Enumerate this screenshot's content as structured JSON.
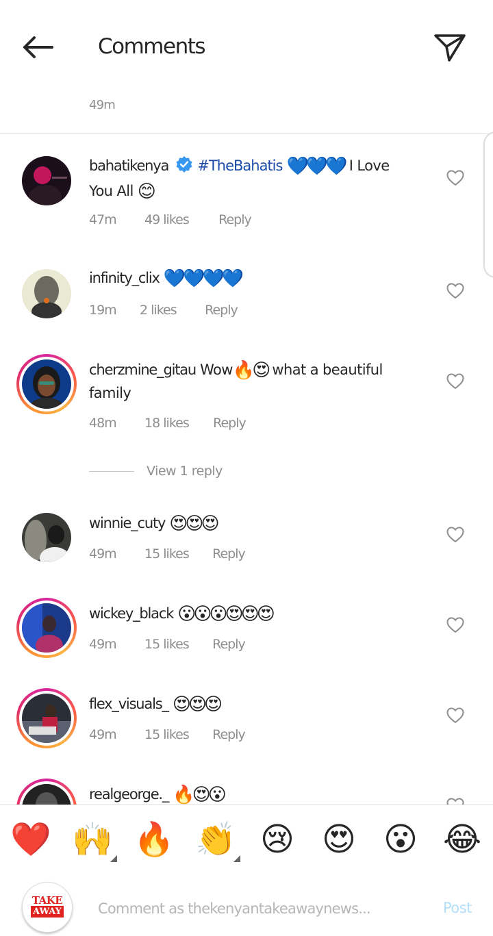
{
  "header": {
    "title": "Comments"
  },
  "top_time": "49m",
  "comments": [
    {
      "username": "bahatikenya",
      "verified": true,
      "hashtag": "#TheBahatis",
      "emoji1": "💙💙💙",
      "text1": " I Love",
      "text2": "You All ",
      "emoji2": "😊",
      "time": "47m",
      "likes": "49 likes",
      "reply": "Reply"
    },
    {
      "username": "infinity_clix",
      "emoji1": "💙💙💙💙",
      "time": "19m",
      "likes": "2 likes",
      "reply": "Reply"
    },
    {
      "username": "cherzmine_gitau",
      "text1": " Wow",
      "emoji1": "🔥😍",
      "text2": " what a beautiful",
      "text3": "family",
      "time": "48m",
      "likes": "18 likes",
      "reply": "Reply"
    },
    {
      "username": "winnie_cuty",
      "emoji1": "😍😍😍",
      "time": "49m",
      "likes": "15 likes",
      "reply": "Reply"
    },
    {
      "username": "wickey_black",
      "emoji1": "😮😮😮😍😍😍",
      "time": "49m",
      "likes": "15 likes",
      "reply": "Reply"
    },
    {
      "username": "flex_visuals_",
      "emoji1": "😍😍😍",
      "time": "49m",
      "likes": "15 likes",
      "reply": "Reply"
    },
    {
      "username": "realgeorge._",
      "emoji1": "🔥😍😮"
    }
  ],
  "view_replies": "View 1 reply",
  "reactions": [
    "❤️",
    "🙌",
    "🔥",
    "👏",
    "😢",
    "😍",
    "😮",
    "😂"
  ],
  "composer": {
    "logo_top": "TAKE",
    "logo_bottom": "AWAY",
    "placeholder": "Comment as thekenyantakeawaynews...",
    "post_label": "Post"
  },
  "colors": {
    "accent_blue": "#0095f6",
    "post_disabled": "#b2dffc",
    "meta_gray": "#8e8e8e"
  }
}
